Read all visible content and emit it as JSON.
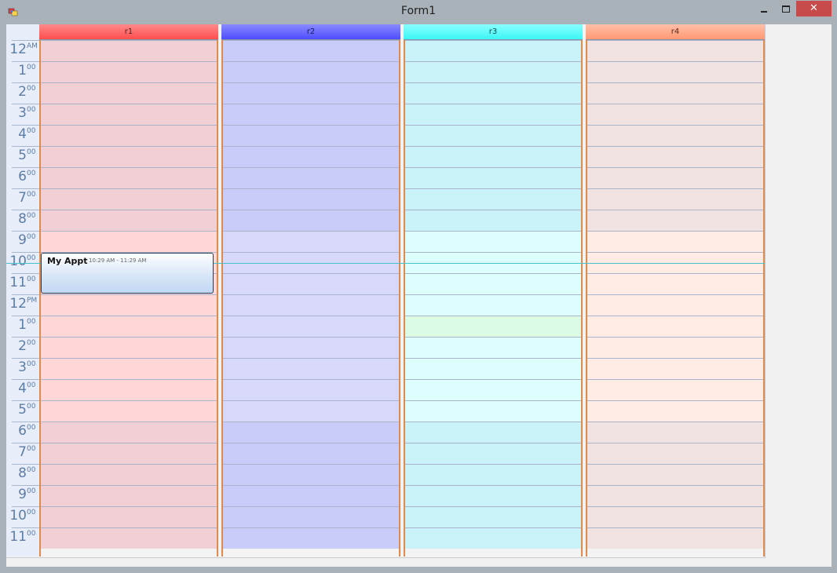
{
  "window": {
    "title": "Form1",
    "close_glyph": "✕"
  },
  "colors": {
    "r1_header": "#ff5a5a",
    "r2_header": "#5a5aff",
    "r3_header": "#55ffff",
    "r4_header": "#ffa78a",
    "time_text": "#5d7ca6",
    "separator": "#e08a4c"
  },
  "resources": [
    {
      "label": "r1"
    },
    {
      "label": "r2"
    },
    {
      "label": "r3"
    },
    {
      "label": "r4"
    }
  ],
  "hours": [
    {
      "num": "12",
      "sup": "AM"
    },
    {
      "num": "1",
      "sup": "00"
    },
    {
      "num": "2",
      "sup": "00"
    },
    {
      "num": "3",
      "sup": "00"
    },
    {
      "num": "4",
      "sup": "00"
    },
    {
      "num": "5",
      "sup": "00"
    },
    {
      "num": "6",
      "sup": "00"
    },
    {
      "num": "7",
      "sup": "00"
    },
    {
      "num": "8",
      "sup": "00"
    },
    {
      "num": "9",
      "sup": "00"
    },
    {
      "num": "10",
      "sup": "00"
    },
    {
      "num": "11",
      "sup": "00"
    },
    {
      "num": "12",
      "sup": "PM"
    },
    {
      "num": "1",
      "sup": "00"
    },
    {
      "num": "2",
      "sup": "00"
    },
    {
      "num": "3",
      "sup": "00"
    },
    {
      "num": "4",
      "sup": "00"
    },
    {
      "num": "5",
      "sup": "00"
    },
    {
      "num": "6",
      "sup": "00"
    },
    {
      "num": "7",
      "sup": "00"
    },
    {
      "num": "8",
      "sup": "00"
    },
    {
      "num": "9",
      "sup": "00"
    },
    {
      "num": "10",
      "sup": "00"
    },
    {
      "num": "11",
      "sup": "00"
    }
  ],
  "appointment": {
    "title": "My Appt",
    "time": "10:29 AM - 11:29 AM"
  }
}
